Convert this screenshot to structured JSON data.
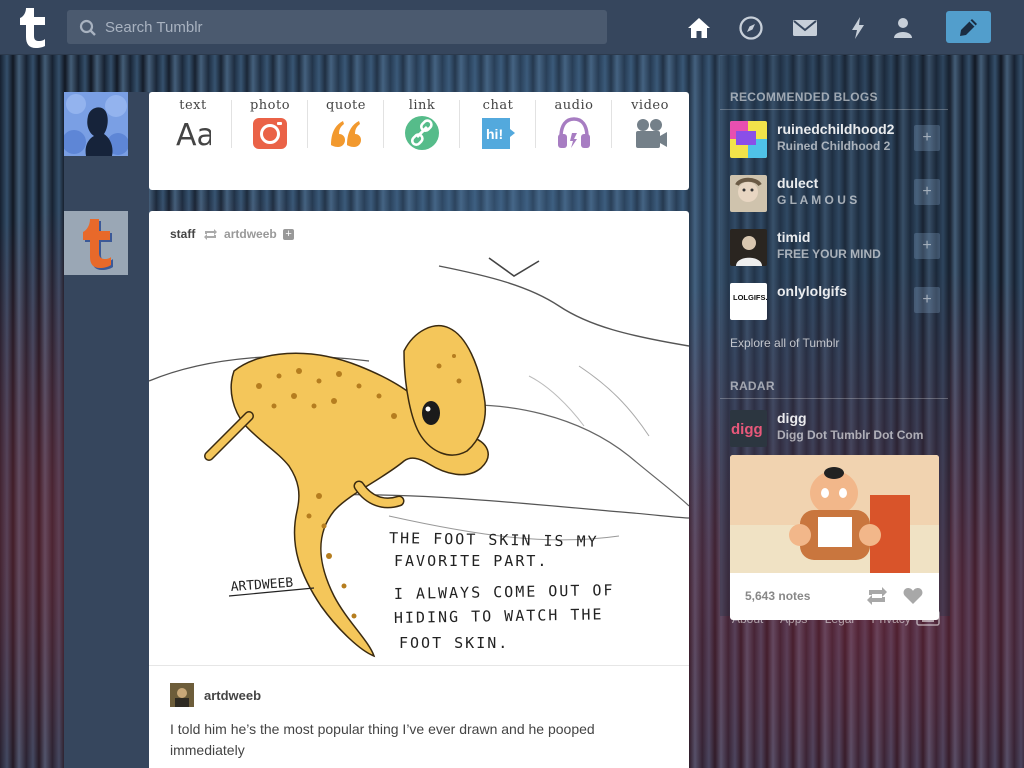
{
  "header": {
    "search_placeholder": "Search Tumblr",
    "nav": [
      "home-icon",
      "explore-icon",
      "inbox-icon",
      "activity-icon",
      "account-icon"
    ],
    "compose_icon": "pencil-icon",
    "colors": {
      "bar": "#36465d",
      "compose": "#529ecc"
    }
  },
  "post_types": [
    {
      "label": "text",
      "icon": "text-icon"
    },
    {
      "label": "photo",
      "icon": "photo-icon"
    },
    {
      "label": "quote",
      "icon": "quote-icon"
    },
    {
      "label": "link",
      "icon": "link-icon"
    },
    {
      "label": "chat",
      "icon": "chat-icon"
    },
    {
      "label": "audio",
      "icon": "audio-icon"
    },
    {
      "label": "video",
      "icon": "video-icon"
    }
  ],
  "post": {
    "blog": "staff",
    "source": "artdweeb",
    "art_signature": "ARTDWEEB",
    "art_text": [
      "THE FOOT SKIN IS MY",
      "FAVORITE PART.",
      "I ALWAYS COME OUT OF",
      "HIDING TO WATCH THE",
      "FOOT SKIN."
    ],
    "caption_blog": "artdweeb",
    "caption": "I told him he’s the most popular thing I’ve ever drawn and he pooped immediately"
  },
  "sidebar": {
    "recommended_title": "RECOMMENDED BLOGS",
    "blogs": [
      {
        "name": "ruinedchildhood2",
        "desc": "Ruined Childhood 2"
      },
      {
        "name": "dulect",
        "desc": "G L A M O U S"
      },
      {
        "name": "timid",
        "desc": "FREE YOUR MIND"
      },
      {
        "name": "onlylolgifs",
        "desc": "",
        "avatar_text": "LOLGIFS.NET"
      }
    ],
    "explore": "Explore all of Tumblr",
    "radar_title": "RADAR",
    "radar_blog": {
      "name": "digg",
      "desc": "Digg Dot Tumblr Dot Com",
      "avatar_text": "digg"
    },
    "radar_notes": "5,643 notes",
    "footer": [
      "About",
      "Apps",
      "Legal",
      "Privacy"
    ]
  }
}
